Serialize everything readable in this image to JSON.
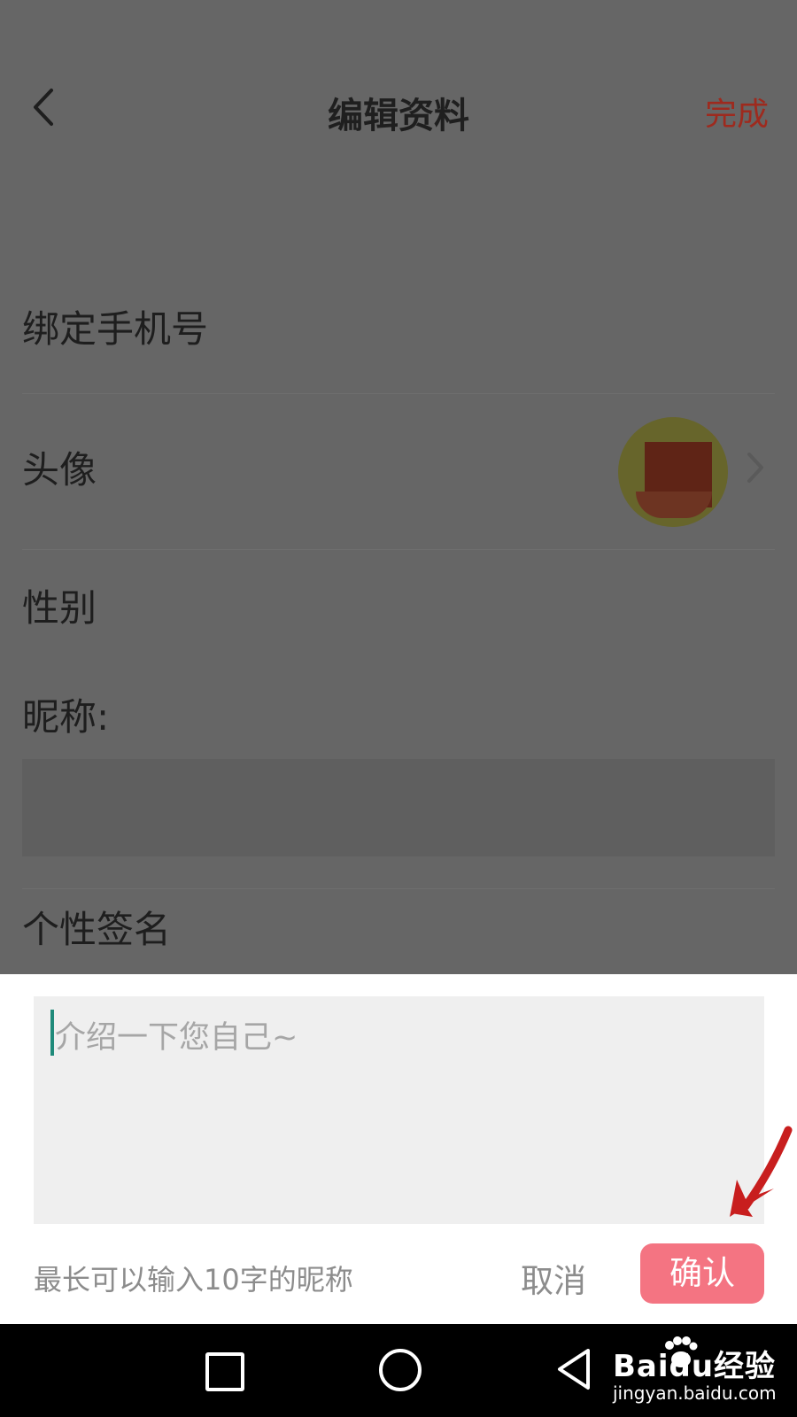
{
  "header": {
    "title": "编辑资料",
    "done_label": "完成"
  },
  "rows": {
    "phone_label": "绑定手机号",
    "avatar_label": "头像",
    "gender_label": "性别",
    "nickname_label": "昵称:",
    "signature_label": "个性签名"
  },
  "sheet": {
    "placeholder": "介绍一下您自己~",
    "hint": "最长可以输入10字的昵称",
    "cancel_label": "取消",
    "confirm_label": "确认"
  },
  "watermark": {
    "brand": "Baidu经验",
    "url": "jingyan.baidu.com"
  },
  "icons": {
    "back": "chevron-left-icon",
    "row_chevron": "chevron-right-icon",
    "nav_recent": "square-icon",
    "nav_home": "circle-icon",
    "nav_back": "triangle-back-icon",
    "annotation": "red-arrow-icon"
  },
  "colors": {
    "overlay": "#666666",
    "done": "#9e2a1e",
    "confirm_bg": "#f47482",
    "caret": "#1f8a7a",
    "arrow": "#c81e1e"
  }
}
